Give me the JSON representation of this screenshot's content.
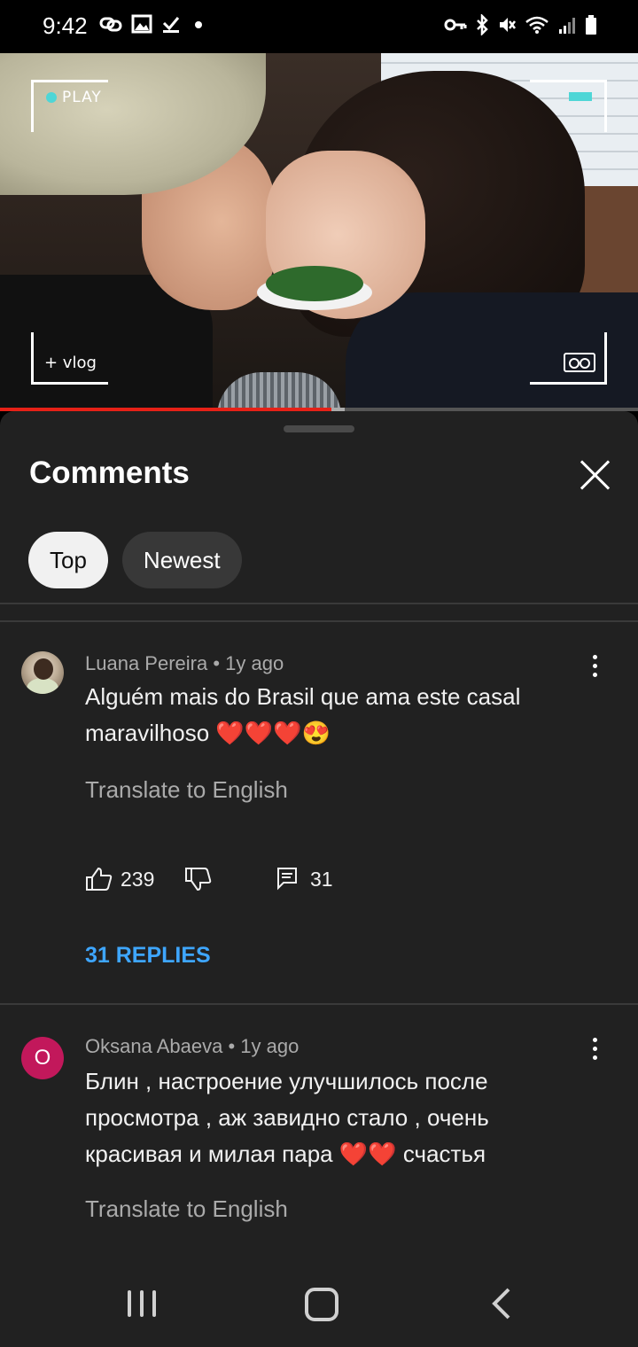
{
  "status_bar": {
    "time": "9:42",
    "left_icons": [
      "link-icon",
      "image-icon",
      "check-icon",
      "dot-icon"
    ],
    "right_icons": [
      "vpn-key-icon",
      "bluetooth-icon",
      "mute-icon",
      "wifi-icon",
      "signal-icon",
      "battery-icon"
    ]
  },
  "video": {
    "overlay_play": "PLAY",
    "overlay_vlog": "+ vlog",
    "progress_fraction": 0.52,
    "buffer_fraction": 0.54
  },
  "comments_panel": {
    "title": "Comments",
    "chips": [
      {
        "label": "Top",
        "active": true
      },
      {
        "label": "Newest",
        "active": false
      }
    ]
  },
  "comments": [
    {
      "author": "Luana Pereira",
      "time": "1y ago",
      "meta": "Luana Pereira • 1y ago",
      "text": "Alguém mais do Brasil que ama este casal maravilhoso ❤️❤️❤️😍",
      "translate": "Translate to English",
      "likes": "239",
      "reply_count": "31",
      "replies_link": "31 REPLIES"
    },
    {
      "author": "Oksana Abaeva",
      "time": "1y ago",
      "meta": "Oksana Abaeva • 1y ago",
      "avatar_letter": "O",
      "avatar_color": "#c2185b",
      "text": "Блин , настроение улучшилось после просмотра , аж завидно  стало , очень красивая и милая пара ❤️❤️ счастья",
      "translate": "Translate to English"
    }
  ],
  "colors": {
    "sheet_background": "#212121",
    "link_blue": "#3ea6ff",
    "progress_red": "#e62117"
  }
}
